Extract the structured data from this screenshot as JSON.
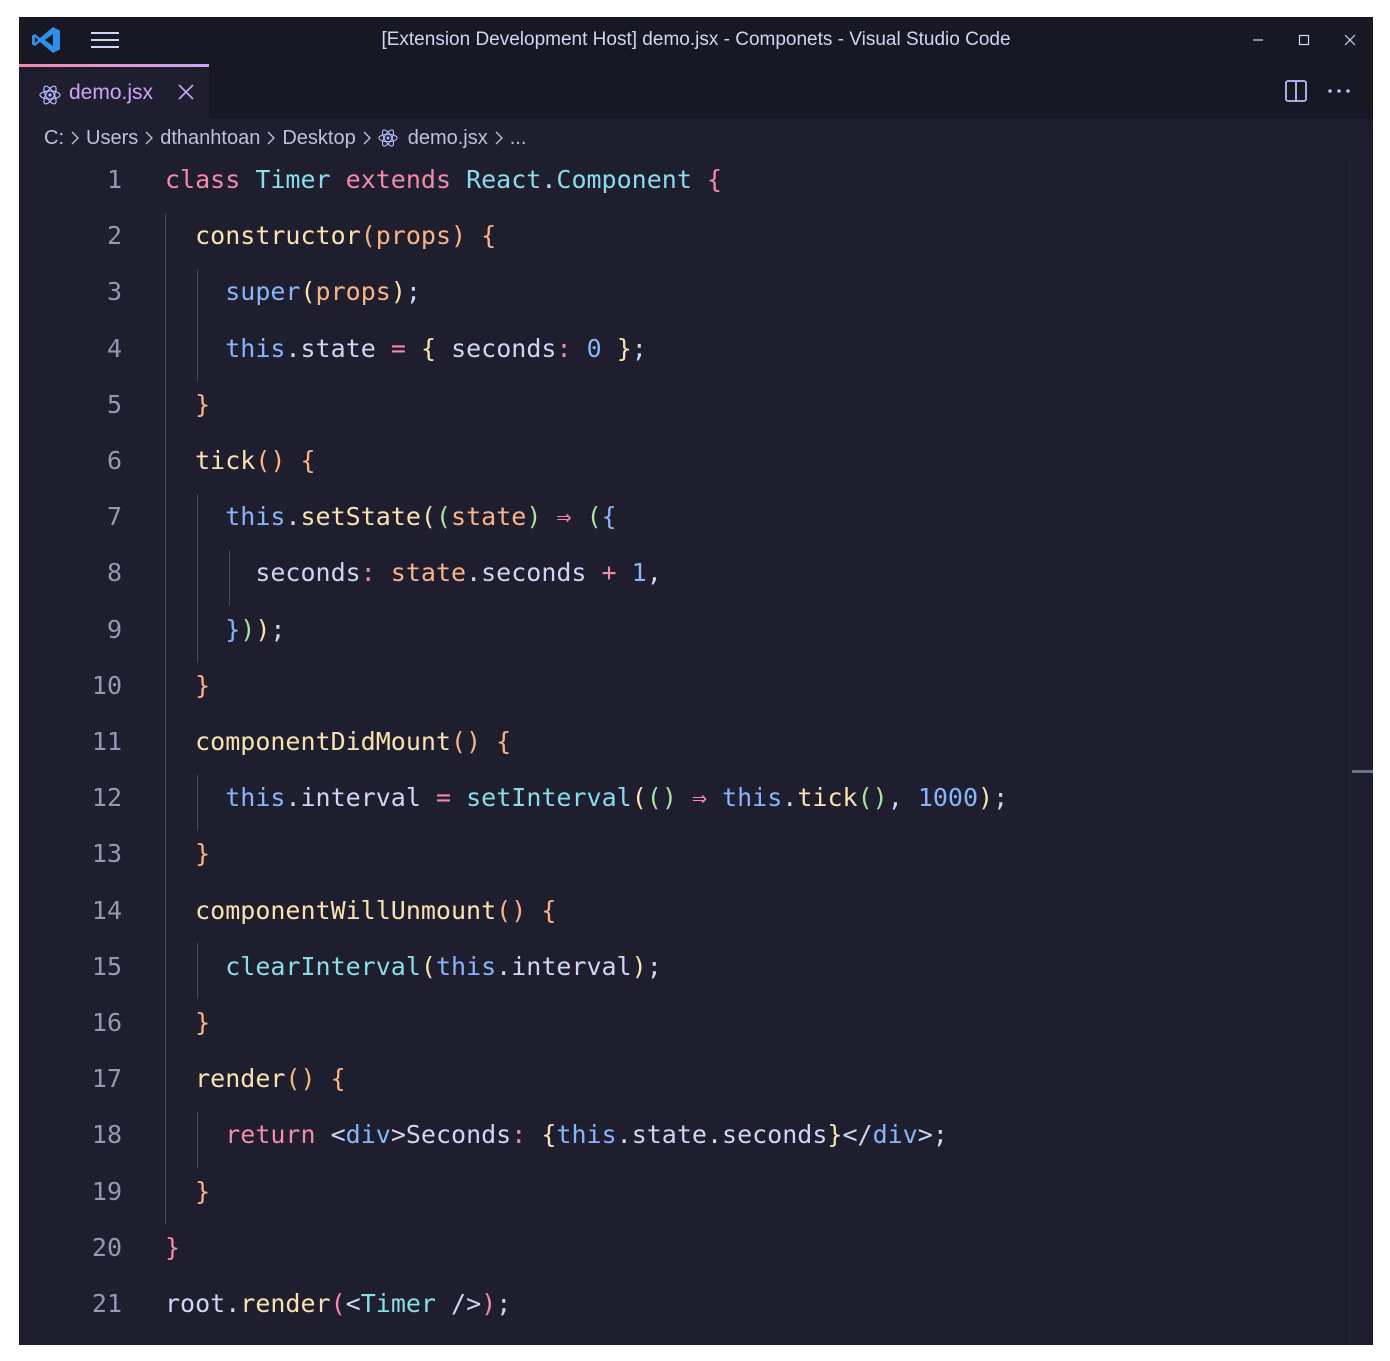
{
  "window": {
    "title": "[Extension Development Host] demo.jsx - Componets - Visual Studio Code",
    "controls": [
      "minimize",
      "maximize",
      "close"
    ]
  },
  "tabs": [
    {
      "label": "demo.jsx",
      "active": true,
      "icon": "react-icon",
      "color": "#cba6f7"
    }
  ],
  "breadcrumb": [
    "C:",
    "Users",
    "dthanhtoan",
    "Desktop",
    "demo.jsx",
    "..."
  ],
  "editor": {
    "language": "jsx",
    "line_numbers": [
      "1",
      "2",
      "3",
      "4",
      "5",
      "6",
      "7",
      "8",
      "9",
      "10",
      "11",
      "12",
      "13",
      "14",
      "15",
      "16",
      "17",
      "18",
      "19",
      "20",
      "21"
    ],
    "lines": [
      "class Timer extends React.Component {",
      "  constructor(props) {",
      "    super(props);",
      "    this.state = { seconds: 0 };",
      "  }",
      "  tick() {",
      "    this.setState((state) => ({",
      "      seconds: state.seconds + 1,",
      "    }));",
      "  }",
      "  componentDidMount() {",
      "    this.interval = setInterval(() => this.tick(), 1000);",
      "  }",
      "  componentWillUnmount() {",
      "    clearInterval(this.interval);",
      "  }",
      "  render() {",
      "    return <div>Seconds: {this.state.seconds}</div>;",
      "  }",
      "}",
      "root.render(<Timer />);"
    ]
  },
  "theme": {
    "background": "#1e1e2e",
    "chrome": "#181825",
    "foreground": "#cdd6f4",
    "accent": "#cba6f7"
  }
}
